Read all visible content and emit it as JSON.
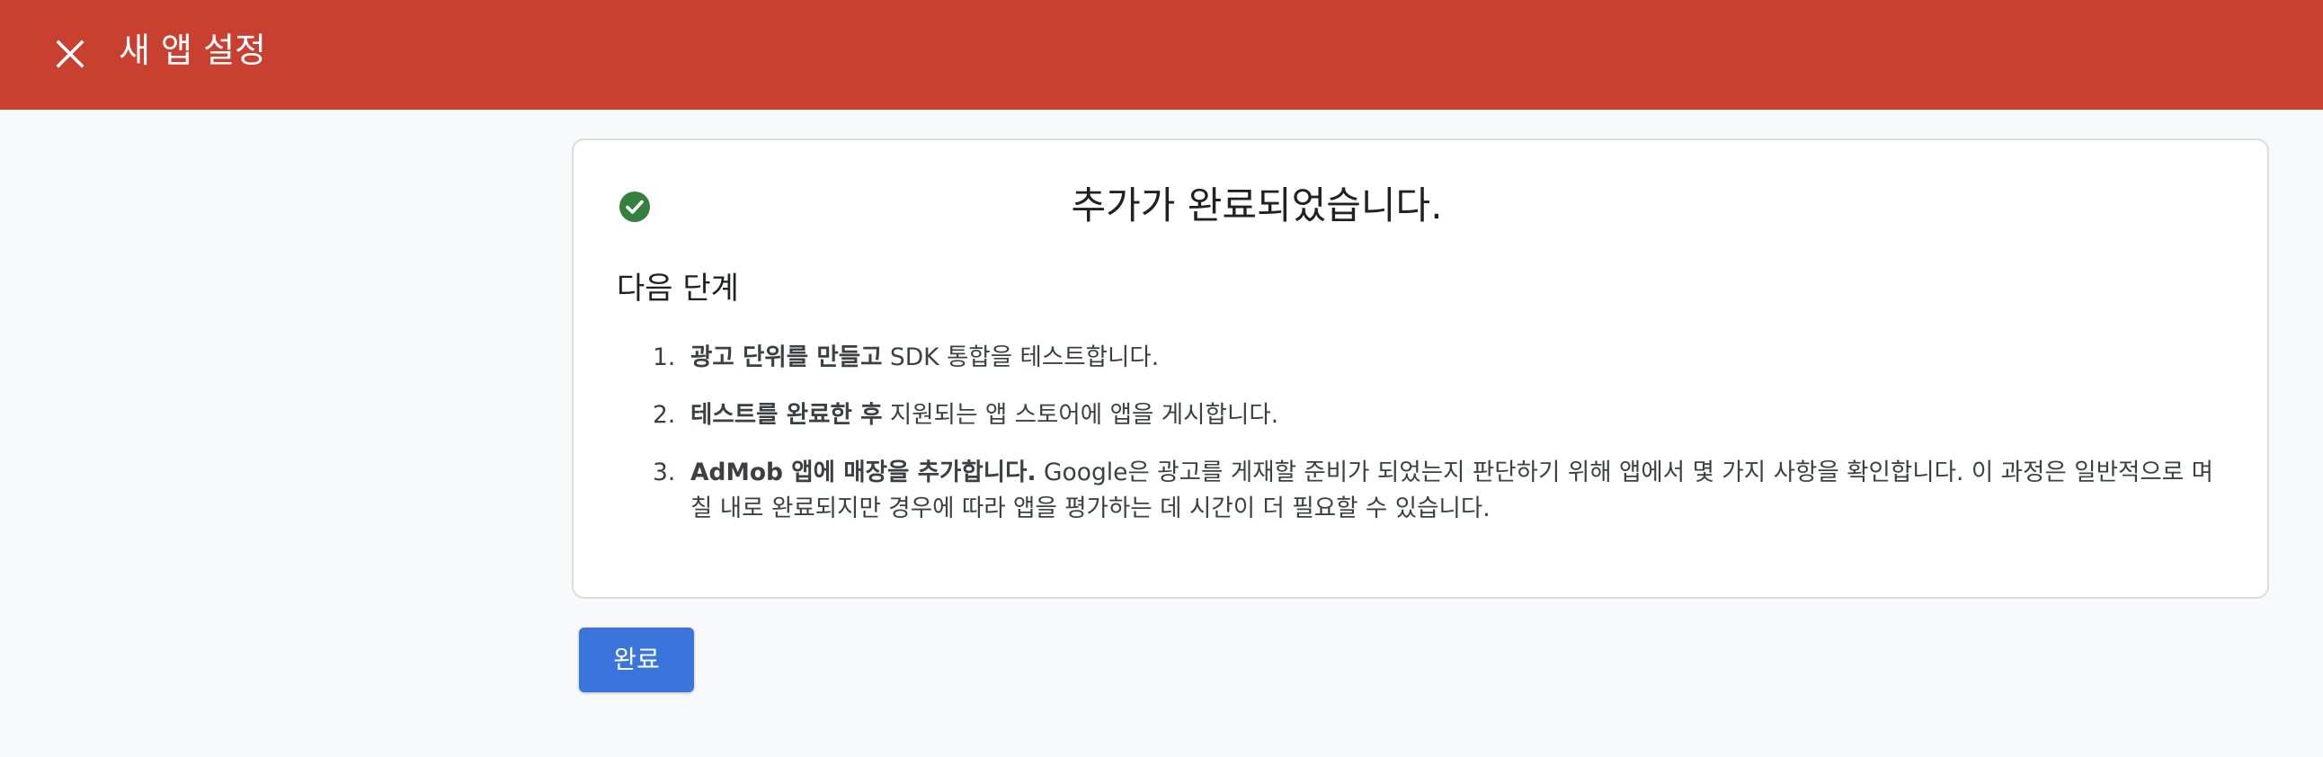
{
  "header": {
    "title": "새 앱 설정",
    "close_icon": "close-icon",
    "background_color": "#c94031"
  },
  "card": {
    "status_icon": "check-circle-icon",
    "status_icon_color": "#34803f",
    "title": "추가가 완료되었습니다.",
    "next_steps_heading": "다음 단계",
    "steps": [
      {
        "number": "1.",
        "bold": "광고 단위를 만들고",
        "text": " SDK 통합을 테스트합니다."
      },
      {
        "number": "2.",
        "bold": "테스트를 완료한 후",
        "text": " 지원되는 앱 스토어에 앱을 게시합니다."
      },
      {
        "number": "3.",
        "bold": "AdMob 앱에 매장을 추가합니다.",
        "text": " Google은 광고를 게재할 준비가 되었는지 판단하기 위해 앱에서 몇 가지 사항을 확인합니다. 이 과정은 일반적으로 며칠 내로 완료되지만 경우에 따라 앱을 평가하는 데 시간이 더 필요할 수 있습니다."
      }
    ]
  },
  "actions": {
    "done_label": "완료",
    "done_color": "#3b74db"
  }
}
